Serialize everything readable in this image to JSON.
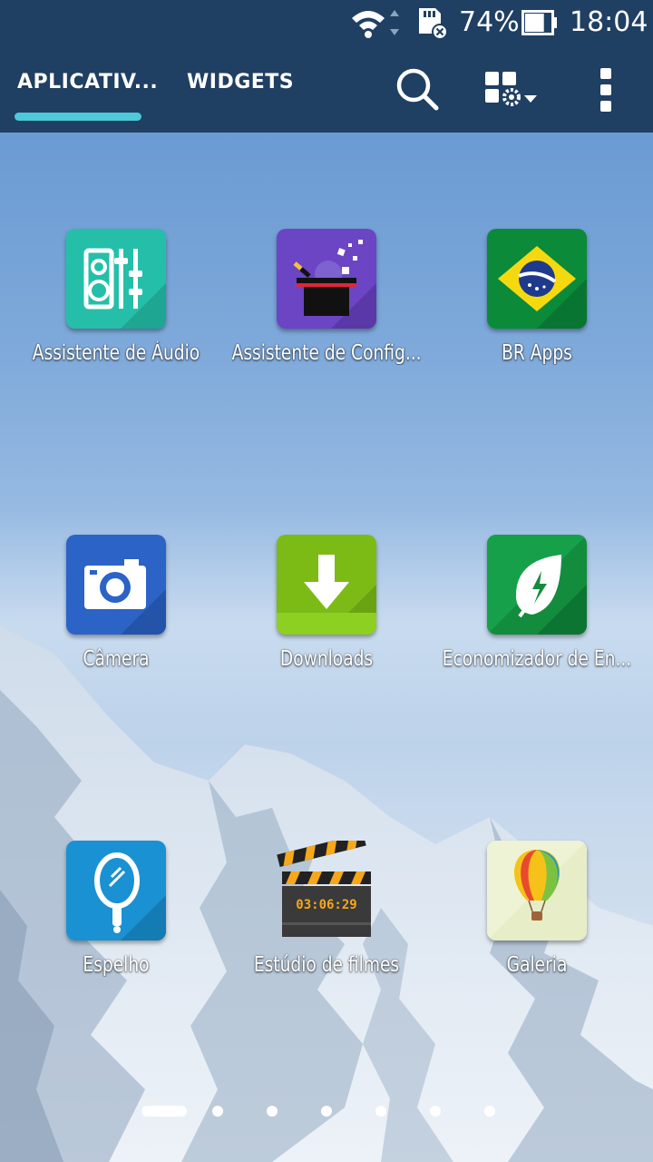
{
  "status_bar": {
    "battery_percent": "74%",
    "time": "18:04",
    "icons": [
      "wifi-icon",
      "sd-card-error-icon",
      "battery-icon"
    ]
  },
  "tabs": [
    {
      "label": "APLICATIV...",
      "selected": true
    },
    {
      "label": "WIDGETS",
      "selected": false
    }
  ],
  "toolbar": {
    "icons": [
      "search-icon",
      "manage-apps-icon",
      "more-options-icon"
    ]
  },
  "apps": [
    {
      "label": "Assistente de Áudio",
      "icon": "audio-wizard-icon"
    },
    {
      "label": "Assistente de Config...",
      "icon": "setup-wizard-icon"
    },
    {
      "label": "BR Apps",
      "icon": "brazil-flag-icon"
    },
    {
      "label": "Câmera",
      "icon": "camera-icon"
    },
    {
      "label": "Downloads",
      "icon": "download-arrow-icon"
    },
    {
      "label": "Economizador de En...",
      "icon": "leaf-bolt-icon"
    },
    {
      "label": "Espelho",
      "icon": "mirror-icon"
    },
    {
      "label": "Estúdio de filmes",
      "icon": "clapperboard-icon",
      "clapper_text": "03:06:29"
    },
    {
      "label": "Galeria",
      "icon": "balloon-icon"
    }
  ],
  "pager": {
    "total_pages": 7,
    "current_page": 1
  },
  "colors": {
    "top_bar": "#1f3f63",
    "tab_indicator": "#4ec9d9"
  }
}
